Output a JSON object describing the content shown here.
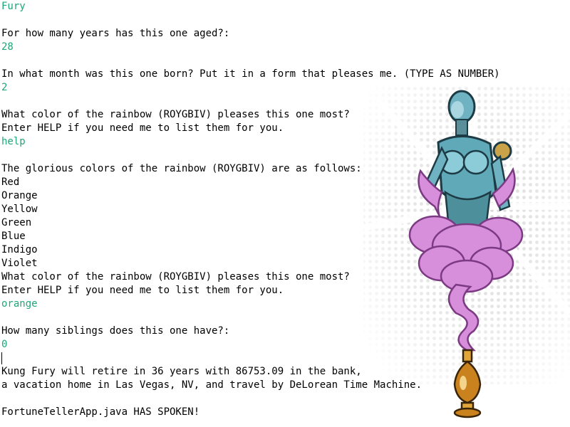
{
  "console": {
    "lines": [
      {
        "type": "input",
        "text": "Fury"
      },
      {
        "type": "output",
        "text": ""
      },
      {
        "type": "output",
        "text": "For how many years has this one aged?:"
      },
      {
        "type": "input",
        "text": "28"
      },
      {
        "type": "output",
        "text": ""
      },
      {
        "type": "output",
        "text": "In what month was this one born? Put it in a form that pleases me. (TYPE AS NUMBER)"
      },
      {
        "type": "input",
        "text": "2"
      },
      {
        "type": "output",
        "text": ""
      },
      {
        "type": "output",
        "text": "What color of the rainbow (ROYGBIV) pleases this one most?"
      },
      {
        "type": "output",
        "text": "Enter HELP if you need me to list them for you."
      },
      {
        "type": "input",
        "text": "help"
      },
      {
        "type": "output",
        "text": ""
      },
      {
        "type": "output",
        "text": "The glorious colors of the rainbow (ROYGBIV) are as follows:"
      },
      {
        "type": "output",
        "text": "Red"
      },
      {
        "type": "output",
        "text": "Orange"
      },
      {
        "type": "output",
        "text": "Yellow"
      },
      {
        "type": "output",
        "text": "Green"
      },
      {
        "type": "output",
        "text": "Blue"
      },
      {
        "type": "output",
        "text": "Indigo"
      },
      {
        "type": "output",
        "text": "Violet"
      },
      {
        "type": "output",
        "text": "What color of the rainbow (ROYGBIV) pleases this one most?"
      },
      {
        "type": "output",
        "text": "Enter HELP if you need me to list them for you."
      },
      {
        "type": "input",
        "text": "orange"
      },
      {
        "type": "output",
        "text": ""
      },
      {
        "type": "output",
        "text": "How many siblings does this one have?:"
      },
      {
        "type": "input",
        "text": "0"
      },
      {
        "type": "cursor",
        "text": ""
      },
      {
        "type": "output",
        "text": "Kung Fury will retire in 36 years with 86753.09 in the bank,"
      },
      {
        "type": "output",
        "text": "a vacation home in Las Vegas, NV, and travel by DeLorean Time Machine."
      },
      {
        "type": "output",
        "text": ""
      },
      {
        "type": "output",
        "text": "FortuneTellerApp.java HAS SPOKEN!"
      }
    ]
  },
  "colors": {
    "output_text": "#000000",
    "input_text": "#1fa67a",
    "background": "#ffffff",
    "genie_cloud": "#d78fdc",
    "genie_metal": "#5fa9b8",
    "lamp": "#c9821e"
  },
  "art": {
    "icon": "robot-genie-with-magic-lamp-illustration"
  }
}
